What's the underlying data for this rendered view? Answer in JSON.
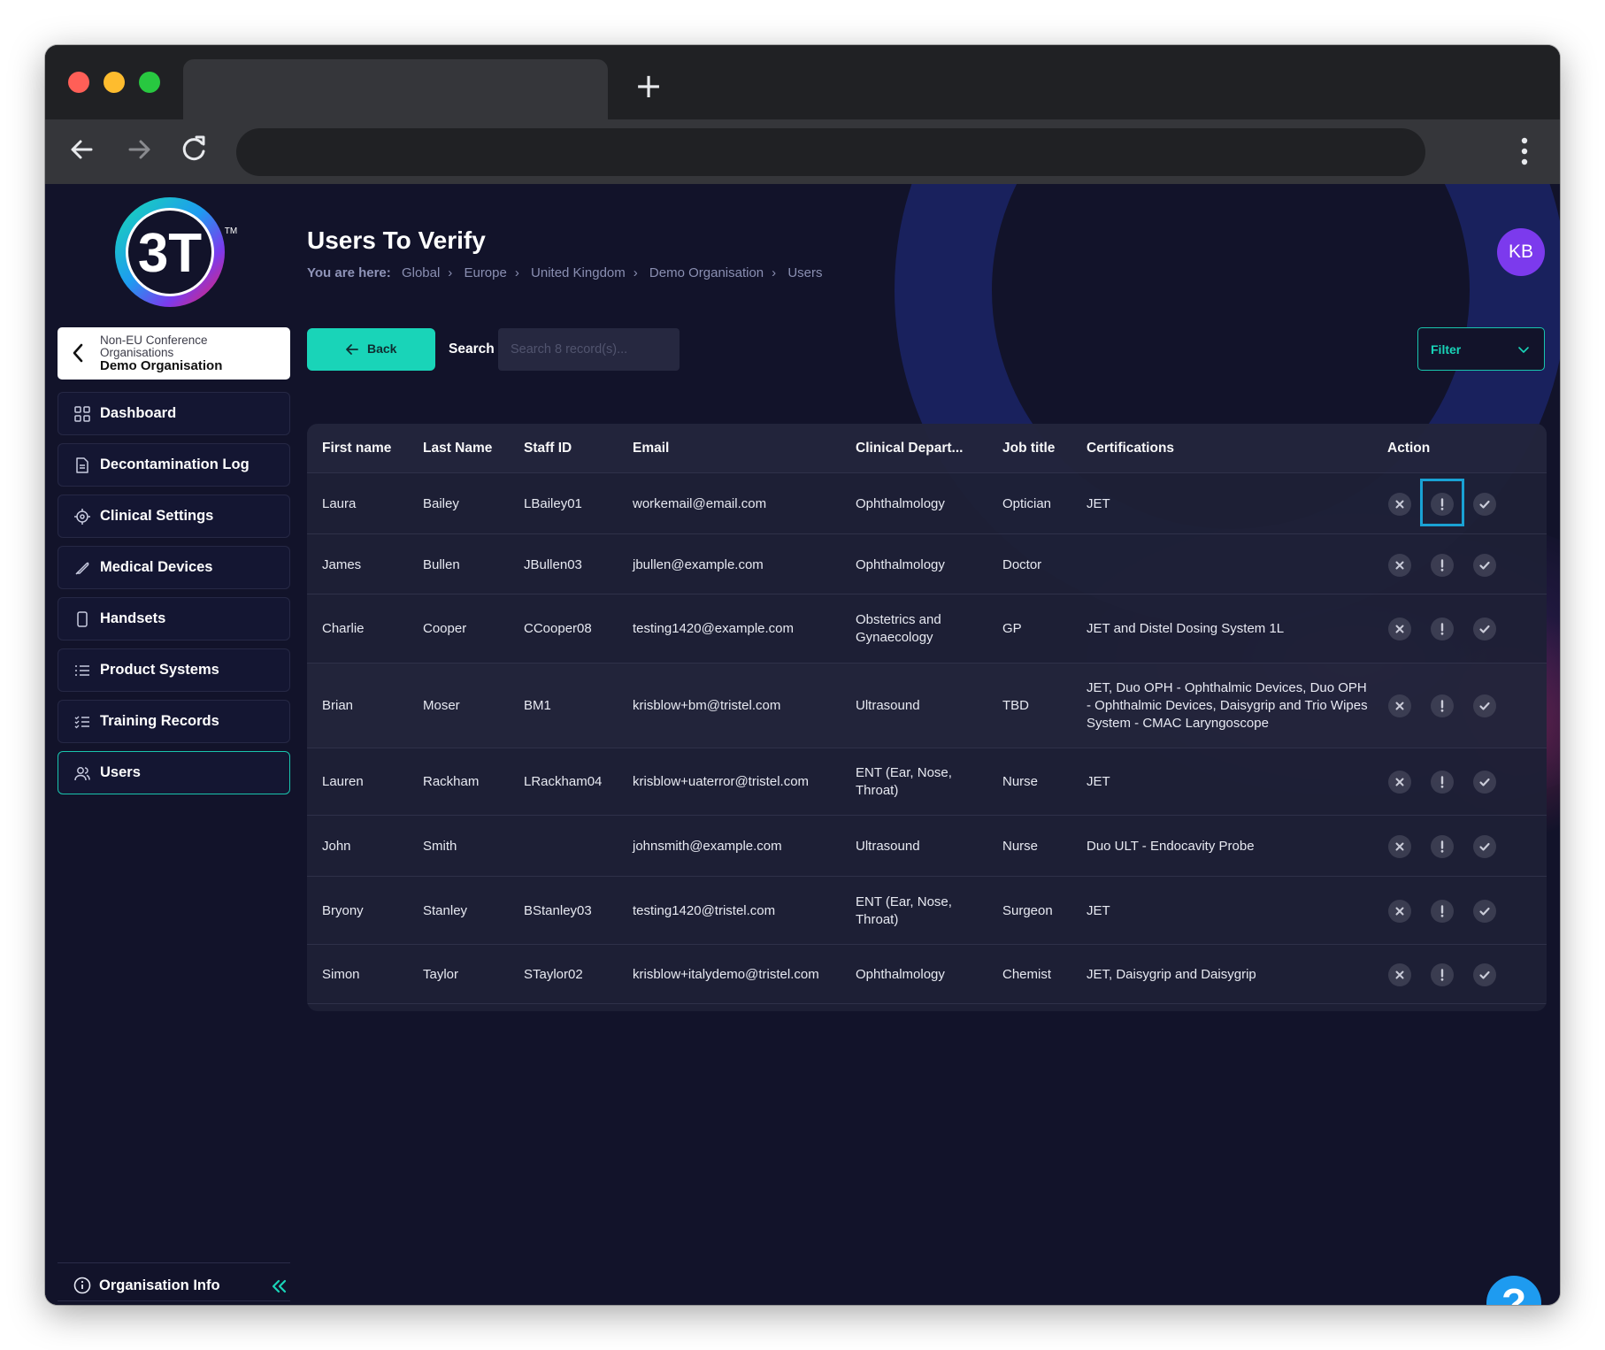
{
  "app": {
    "logo_text": "3T",
    "logo_tm": "TM",
    "avatar_initials": "KB",
    "page_title": "Users To Verify"
  },
  "org_card": {
    "parent": "Non-EU Conference Organisations",
    "name": "Demo Organisation"
  },
  "sidebar": {
    "items": [
      {
        "label": "Dashboard",
        "icon": "grid-icon"
      },
      {
        "label": "Decontamination Log",
        "icon": "document-icon"
      },
      {
        "label": "Clinical Settings",
        "icon": "crosshair-icon"
      },
      {
        "label": "Medical Devices",
        "icon": "feather-icon"
      },
      {
        "label": "Handsets",
        "icon": "phone-icon"
      },
      {
        "label": "Product Systems",
        "icon": "list-icon"
      },
      {
        "label": "Training Records",
        "icon": "checklist-icon"
      },
      {
        "label": "Users",
        "icon": "users-icon",
        "active": true
      }
    ],
    "footer": {
      "label": "Organisation Info",
      "icon": "info-icon"
    }
  },
  "breadcrumb": {
    "prefix": "You are here:",
    "items": [
      "Global",
      "Europe",
      "United Kingdom",
      "Demo Organisation",
      "Users"
    ]
  },
  "toolbar": {
    "back_label": "Back",
    "search_label": "Search",
    "search_placeholder": "Search 8 record(s)...",
    "filter_label": "Filter"
  },
  "table": {
    "headers": [
      "First name",
      "Last Name",
      "Staff ID",
      "Email",
      "Clinical Depart...",
      "Job title",
      "Certifications",
      "Action"
    ],
    "rows": [
      {
        "first": "Laura",
        "last": "Bailey",
        "staff": "LBailey01",
        "email": "workemail@email.com",
        "dept": "Ophthalmology",
        "job": "Optician",
        "certs": "JET"
      },
      {
        "first": "James",
        "last": "Bullen",
        "staff": "JBullen03",
        "email": "jbullen@example.com",
        "dept": "Ophthalmology",
        "job": "Doctor",
        "certs": ""
      },
      {
        "first": "Charlie",
        "last": "Cooper",
        "staff": "CCooper08",
        "email": "testing1420@example.com",
        "dept": "Obstetrics and Gynaecology",
        "job": "GP",
        "certs": "JET and Distel Dosing System 1L"
      },
      {
        "first": "Brian",
        "last": "Moser",
        "staff": "BM1",
        "email": "krisblow+bm@tristel.com",
        "dept": "Ultrasound",
        "job": "TBD",
        "certs": "JET, Duo OPH - Ophthalmic Devices, Duo OPH - Ophthalmic Devices, Daisygrip and Trio Wipes System - CMAC Laryngoscope"
      },
      {
        "first": "Lauren",
        "last": "Rackham",
        "staff": "LRackham04",
        "email": "krisblow+uaterror@tristel.com",
        "dept": "ENT (Ear, Nose, Throat)",
        "job": "Nurse",
        "certs": "JET"
      },
      {
        "first": "John",
        "last": "Smith",
        "staff": "",
        "email": "johnsmith@example.com",
        "dept": "Ultrasound",
        "job": "Nurse",
        "certs": "Duo ULT - Endocavity Probe"
      },
      {
        "first": "Bryony",
        "last": "Stanley",
        "staff": "BStanley03",
        "email": "testing1420@tristel.com",
        "dept": "ENT (Ear, Nose, Throat)",
        "job": "Surgeon",
        "certs": "JET"
      },
      {
        "first": "Simon",
        "last": "Taylor",
        "staff": "STaylor02",
        "email": "krisblow+italydemo@tristel.com",
        "dept": "Ophthalmology",
        "job": "Chemist",
        "certs": "JET, Daisygrip and Daisygrip"
      }
    ],
    "action_icons": [
      "reject-icon",
      "flag-icon",
      "approve-icon"
    ]
  },
  "colors": {
    "accent": "#19d4b8",
    "background": "#12132a",
    "avatar": "#7c3aed",
    "help": "#1e9bf0",
    "highlight": "#1aa7d8"
  }
}
